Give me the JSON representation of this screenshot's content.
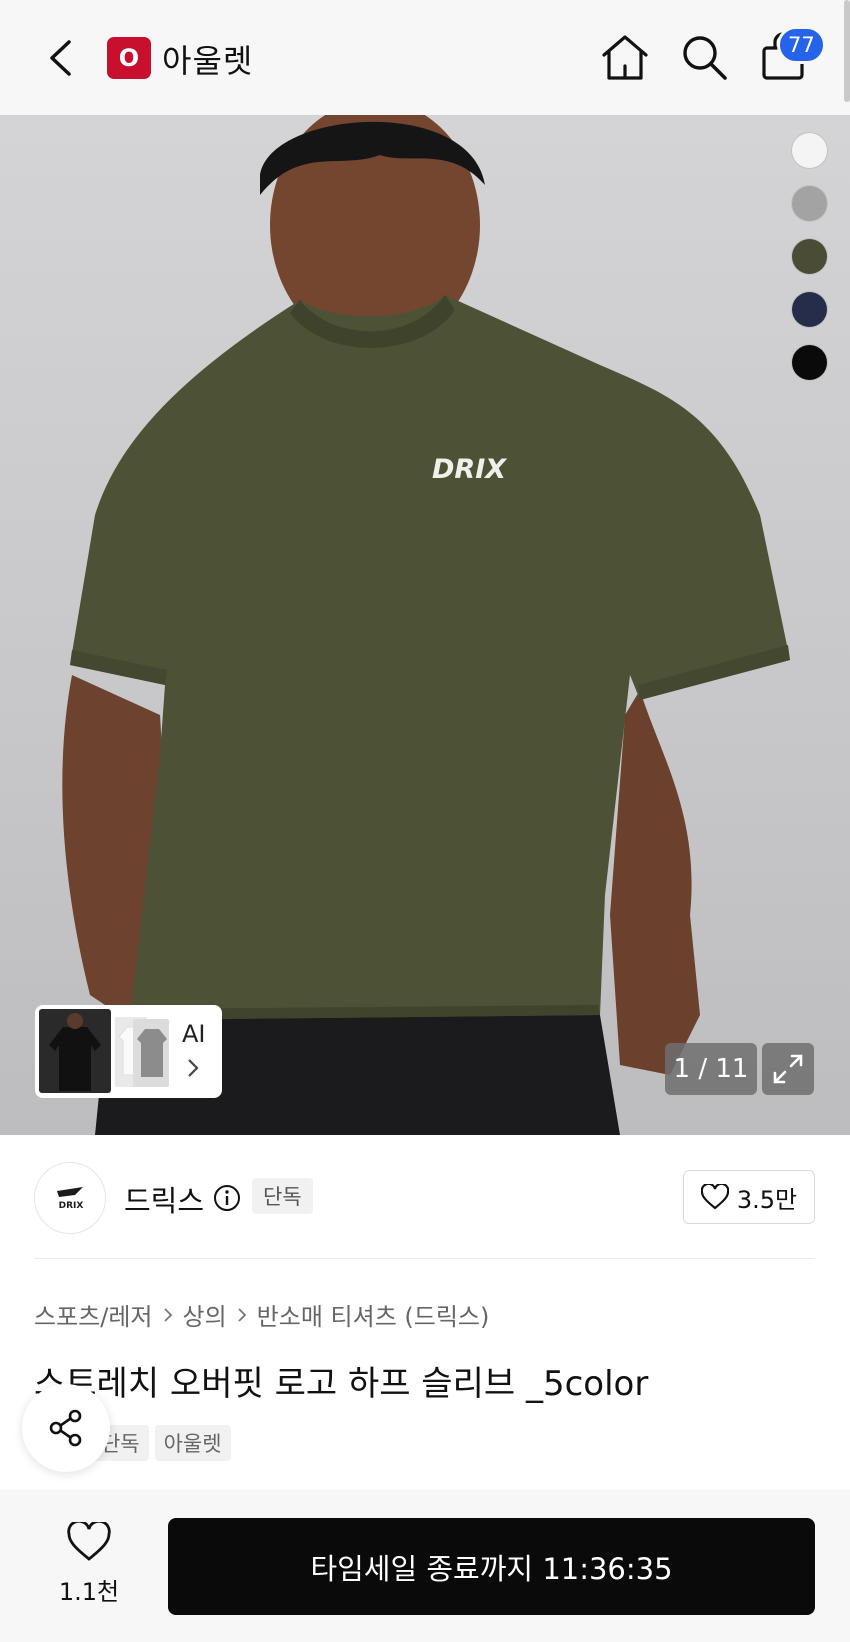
{
  "header": {
    "logo_letter": "O",
    "title": "아울렛",
    "cart_count": "77",
    "icons": [
      "chevron-left-icon",
      "home-icon",
      "search-icon",
      "cart-icon"
    ]
  },
  "gallery": {
    "print_logo": "DRIX",
    "ai_label": "AI",
    "counter": "1 / 11",
    "color_options": [
      {
        "name": "white",
        "hex": "#f4f4f4"
      },
      {
        "name": "gray",
        "hex": "#a3a3a3"
      },
      {
        "name": "khaki",
        "hex": "#4a4c36"
      },
      {
        "name": "navy",
        "hex": "#262d4a"
      },
      {
        "name": "black",
        "hex": "#0a0a0a"
      }
    ]
  },
  "seller": {
    "logo_text": "DRIX",
    "name": "드릭스",
    "badge": "단독",
    "likes": "3.5만"
  },
  "product": {
    "breadcrumbs": [
      "스포츠/레저",
      "상의",
      "반소매 티셔츠 (드릭스)"
    ],
    "title": "스트레치 오버핏 로고 하프 슬리브 _5color",
    "tags": [
      "무신사단독",
      "아울렛"
    ]
  },
  "bottom_bar": {
    "wish_count": "1.1천",
    "cta_label": "타임세일 종료까지 11:36:35"
  },
  "colors": {
    "brand_red": "#c8102e",
    "badge_blue": "#2563eb",
    "cta_black": "#0a0a0a"
  }
}
